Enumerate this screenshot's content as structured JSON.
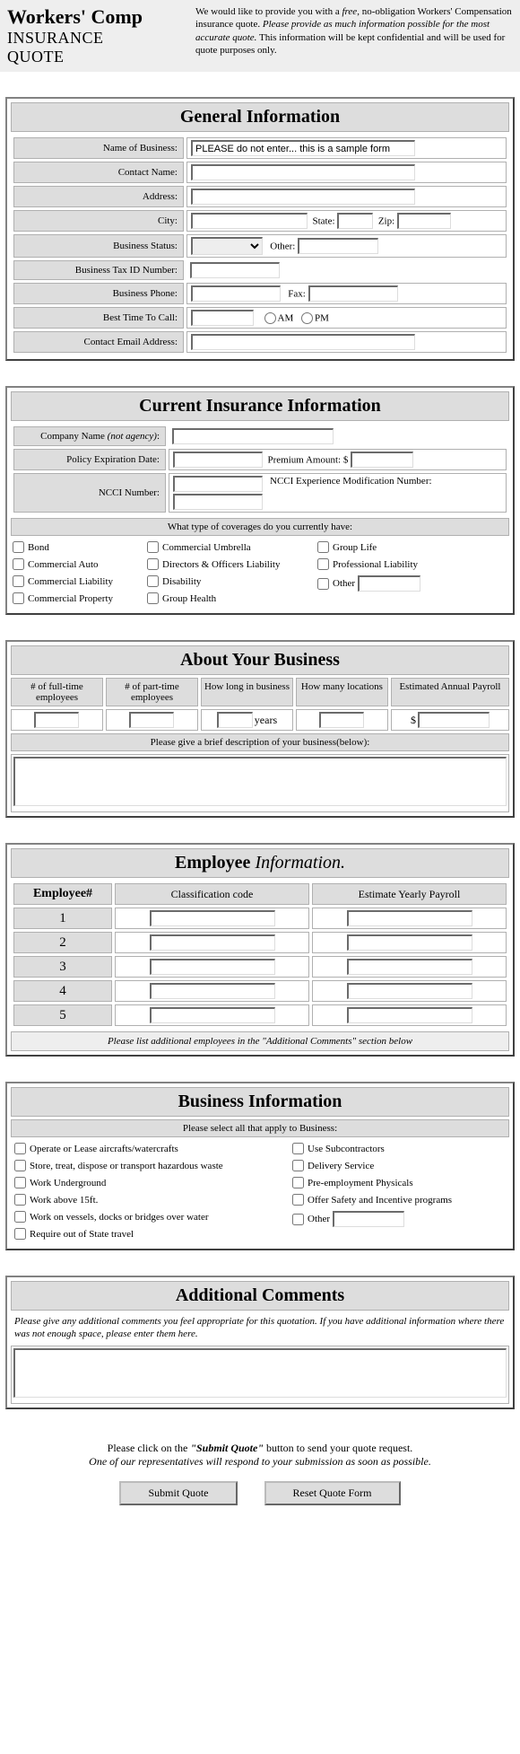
{
  "header": {
    "title_line1": "Workers' Comp",
    "title_line2": "INSURANCE",
    "title_line3": "QUOTE",
    "blurb_pre": "We would like to provide you with a ",
    "blurb_free": "free",
    "blurb_mid": ", no-obligation Workers' Compensation insurance quote. ",
    "blurb_em": "Please provide as much information possible for the most accurate quote.",
    "blurb_post": " This information will be kept confidential and will be used for quote purposes only."
  },
  "general": {
    "title": "General Information",
    "labels": {
      "name": "Name of Business:",
      "contact": "Contact Name:",
      "address": "Address:",
      "city": "City:",
      "state": "State:",
      "zip": "Zip:",
      "status": "Business Status:",
      "other": "Other:",
      "taxid": "Business Tax ID Number:",
      "phone": "Business Phone:",
      "fax": "Fax:",
      "bestcall": "Best Time To Call:",
      "am": "AM",
      "pm": "PM",
      "email": "Contact Email Address:"
    },
    "name_value": "PLEASE do not enter... this is a sample form"
  },
  "current": {
    "title": "Current Insurance Information",
    "labels": {
      "company": "Company Name ",
      "company_em": "(not agency)",
      "company_colon": ":",
      "expire": "Policy Expiration Date:",
      "premium": "Premium Amount: $",
      "ncci": "NCCI Number:",
      "ncci_mod": "NCCI Experience Modification Number:",
      "covq": "What type of coverages do you currently have:"
    },
    "cov": {
      "bond": "Bond",
      "comm_auto": "Commercial Auto",
      "comm_liab": "Commercial Liability",
      "comm_prop": "Commercial Property",
      "comm_umb": "Commercial Umbrella",
      "dando": "Directors & Officers Liability",
      "disability": "Disability",
      "grp_health": "Group Health",
      "grp_life": "Group Life",
      "prof_liab": "Professional Liability",
      "other": "Other"
    }
  },
  "about": {
    "title": "About Your Business",
    "headers": {
      "ft": "# of full-time employees",
      "pt": "# of part-time employees",
      "howlong": "How long in business",
      "locations": "How many locations",
      "payroll": "Estimated Annual Payroll"
    },
    "years": "years",
    "dollar": "$",
    "desc": "Please give a brief description of your business(below):"
  },
  "emp": {
    "title_a": "Employee ",
    "title_b": "Information.",
    "headers": {
      "num": "Employee#",
      "class": "Classification code",
      "pay": "Estimate Yearly Payroll"
    },
    "rows": [
      "1",
      "2",
      "3",
      "4",
      "5"
    ],
    "note": "Please list additional employees in the \"Additional Comments\" section below"
  },
  "binfo": {
    "title": "Business Information",
    "sub": "Please select all that apply to Business:",
    "left": {
      "aircraft": "Operate or Lease aircrafts/watercrafts",
      "hazwaste": "Store, treat, dispose or transport hazardous waste",
      "underground": "Work Underground",
      "above15": "Work above 15ft.",
      "vessels": "Work on vessels, docks or bridges over water",
      "outofstate": "Require out of State travel"
    },
    "right": {
      "subcon": "Use Subcontractors",
      "delivery": "Delivery Service",
      "physicals": "Pre-employment Physicals",
      "safety": "Offer Safety and Incentive programs",
      "other": "Other"
    }
  },
  "comments": {
    "title": "Additional Comments",
    "note": "Please give any additional comments you feel appropriate for this quotation. If you have additional information where there was not enough space, please enter them here."
  },
  "footer": {
    "line1_a": "Please click on the ",
    "line1_b": "\"Submit Quote\"",
    "line1_c": " button to send your quote request.",
    "line2": "One of our representatives will respond to your submission as soon as possible.",
    "submit": "Submit Quote",
    "reset": "Reset Quote Form"
  }
}
